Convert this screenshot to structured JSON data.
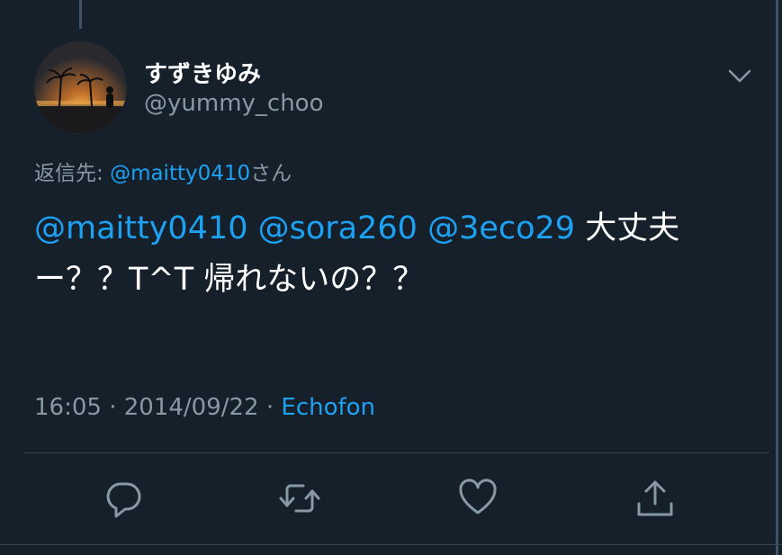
{
  "tweet": {
    "author": {
      "display_name": "すずきゆみ",
      "handle": "@yummy_choo"
    },
    "reply_to": {
      "prefix": "返信先: ",
      "mention": "@maitty0410",
      "suffix": "さん"
    },
    "text": {
      "mention_1": "@maitty0410",
      "mention_2": "@sora260",
      "mention_3": "@3eco29",
      "body": "大丈夫ー？？T^T 帰れないの？？"
    },
    "meta": {
      "time": "16:05",
      "separator": " · ",
      "date": "2014/09/22",
      "source": "Echofon"
    }
  },
  "icons": {
    "more": "chevron-down-icon",
    "reply": "reply-icon",
    "retweet": "retweet-icon",
    "like": "heart-icon",
    "share": "share-icon"
  },
  "colors": {
    "background": "#15202b",
    "accent": "#1da1f2",
    "secondary_text": "#8899a6",
    "divider": "#38444d"
  }
}
